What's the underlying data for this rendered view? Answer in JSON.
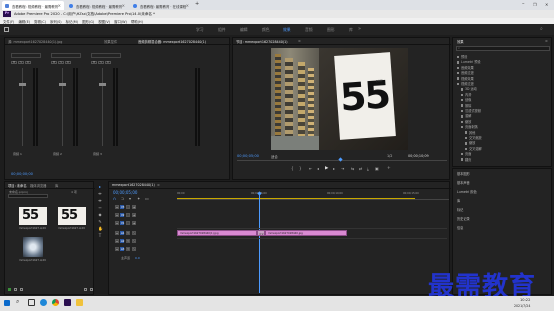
{
  "browser": {
    "tabs": [
      {
        "label": "查看教程: 视频教程 · 最需教育",
        "active": true,
        "color": "#4f7fd9"
      },
      {
        "label": "查看教程: 视频教程 · 最需教育",
        "active": false,
        "color": "#3f7ee8"
      },
      {
        "label": "查看教程: 最需教育 · 在线课程",
        "active": false,
        "color": "#3f7ee8"
      }
    ],
    "new_tab": "+",
    "window_controls": [
      "–",
      "❐",
      "✕"
    ]
  },
  "app": {
    "logo_text": "Pr",
    "title": "Adobe Premiere Pro 2020 - C:\\用户\\HZsx\\文档\\Adobe\\Premiere Pro\\14.0\\未命名 *"
  },
  "menu": [
    "文件(F)",
    "编辑(E)",
    "剪辑(C)",
    "序列(S)",
    "标记(M)",
    "图形(G)",
    "视图(V)",
    "窗口(W)",
    "帮助(H)"
  ],
  "workspaces": {
    "items": [
      "学习",
      "组件",
      "编辑",
      "颜色",
      "效果",
      "音频",
      "图形",
      "库"
    ],
    "active_index": 4
  },
  "source_panel": {
    "tabs": [
      "源: mmexport1627028440(1).jpg",
      "效果控件",
      "音频剪辑混合器: mmexport1627028440(1)"
    ],
    "active_index": 2,
    "db_ticks": [
      "0",
      "-6",
      "-12",
      "-18",
      "-24",
      "-30",
      "-36",
      "-42",
      "-48",
      "-54",
      "dB"
    ],
    "track_labels": [
      "音频 1",
      "音频 2",
      "音频 3"
    ],
    "solo_labels": [
      "M",
      "S",
      "R"
    ],
    "timecode": "00;00;00;00"
  },
  "program_panel": {
    "tab": "节目: mmexport1627028440(1)",
    "menu_icon": "≡",
    "timecode_left": "00;00;05;00",
    "fit_label": "适合",
    "quality_label": "完整",
    "page_indicator": "1/2",
    "timecode_right": "00;00;10;09",
    "image_number": "55",
    "image_suffix": "EXIT",
    "transport_buttons": [
      "{",
      "}",
      "⇤",
      "◂",
      "▶",
      "▸",
      "⇥",
      "⇆",
      "⇄",
      "⤓",
      "▣",
      "+"
    ]
  },
  "effects_panel": {
    "title": "效果",
    "menu_icon": "≡",
    "search_placeholder": "",
    "tree": [
      {
        "label": "预设",
        "indent": 0
      },
      {
        "label": "Lumetri 预设",
        "indent": 0
      },
      {
        "label": "音频效果",
        "indent": 0
      },
      {
        "label": "音频过渡",
        "indent": 0
      },
      {
        "label": "视频效果",
        "indent": 0
      },
      {
        "label": "视频过渡",
        "indent": 0
      },
      {
        "label": "3D 运动",
        "indent": 1
      },
      {
        "label": "内滑",
        "indent": 1
      },
      {
        "label": "划像",
        "indent": 1
      },
      {
        "label": "擦除",
        "indent": 1
      },
      {
        "label": "沉浸式视频",
        "indent": 1
      },
      {
        "label": "溶解",
        "indent": 1
      },
      {
        "label": "缩放",
        "indent": 1
      },
      {
        "label": "页面剥落",
        "indent": 1
      },
      {
        "label": "其他",
        "indent": 2
      },
      {
        "label": "交叉缩放",
        "indent": 2
      },
      {
        "label": "缩放",
        "indent": 2
      },
      {
        "label": "交叉溶解",
        "indent": 2
      },
      {
        "label": "页面",
        "indent": 1
      },
      {
        "label": "翻页",
        "indent": 1
      }
    ],
    "bottom_panels": [
      "基本图形",
      "基本声音",
      "Lumetri 颜色",
      "库",
      "标记",
      "历史记录",
      "信息"
    ]
  },
  "project_panel": {
    "tabs": [
      "项目: 未命名",
      "媒体浏览器",
      "库",
      "信息",
      "效果",
      "标记"
    ],
    "active_index": 0,
    "filename": "未命名.prproj",
    "item_count": "4 项",
    "items": [
      {
        "name": "mmexport1627...",
        "duration": "4;29"
      },
      {
        "name": "mmexport1627...",
        "duration": "4;29"
      },
      {
        "name": "mmexport1627...",
        "duration": "4;29"
      }
    ]
  },
  "tools": [
    "▸",
    "⇹",
    "⇼",
    "⇿",
    "◆",
    "✎",
    "✋",
    "T"
  ],
  "timeline": {
    "tab": "mmexport1627028440(1)",
    "menu_icon": "≡",
    "timecode": "00;00;05;00",
    "ruler_labels": [
      "00;00",
      "00;00;05;00",
      "00;00;10;00",
      "00;00;15;00"
    ],
    "video_tracks": [
      "V3",
      "V2",
      "V1"
    ],
    "audio_tracks": [
      "A1",
      "A2",
      "A3"
    ],
    "master_label": "主声道",
    "master_value": "0.0",
    "clips": [
      {
        "label": "mmexport1627028440(1).jpg"
      },
      {
        "label": "交叉"
      },
      {
        "label": "mmexport1627028440.jpg"
      }
    ]
  },
  "watermark": {
    "text": "最需教育",
    "color": "#2233cc"
  },
  "taskbar": {
    "search_icon": "search-icon",
    "icons": [
      "windows-icon",
      "search-icon",
      "task-view-icon",
      "edge-icon",
      "chrome-icon",
      "premiere-icon",
      "folder-icon"
    ],
    "time": "10:22",
    "date": "2021/7/24"
  }
}
